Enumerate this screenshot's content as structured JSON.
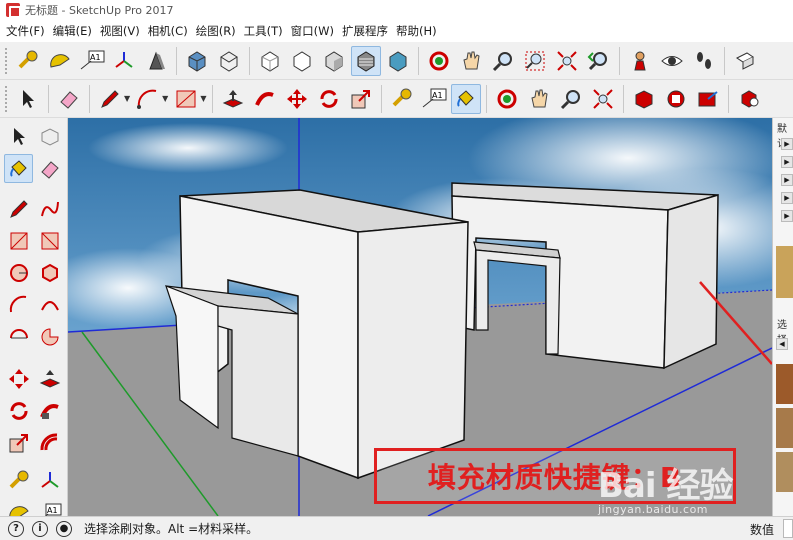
{
  "window": {
    "title": "无标题 - SketchUp Pro 2017"
  },
  "menu": [
    "文件(F)",
    "编辑(E)",
    "视图(V)",
    "相机(C)",
    "绘图(R)",
    "工具(T)",
    "窗口(W)",
    "扩展程序",
    "帮助(H)"
  ],
  "toolbar_text": {
    "dim_icon": "A1",
    "dim_icon_2": "A1",
    "left_dim_icon": "A1"
  },
  "canvas": {
    "caption": "填充材质快捷键：B",
    "watermark_logo": "Bai 经验",
    "watermark_url": "jingyan.baidu.com"
  },
  "right_panel": {
    "label_top": "默认",
    "label_mid": "选择"
  },
  "status": {
    "message": "选择涂刷对象。Alt =材料采样。",
    "value_label": "数值",
    "value": ""
  },
  "colors": {
    "caption_red": "#e02020",
    "axis_blue": "#1f2bd6",
    "axis_green": "#1e9a2a",
    "ground": "#999999"
  }
}
